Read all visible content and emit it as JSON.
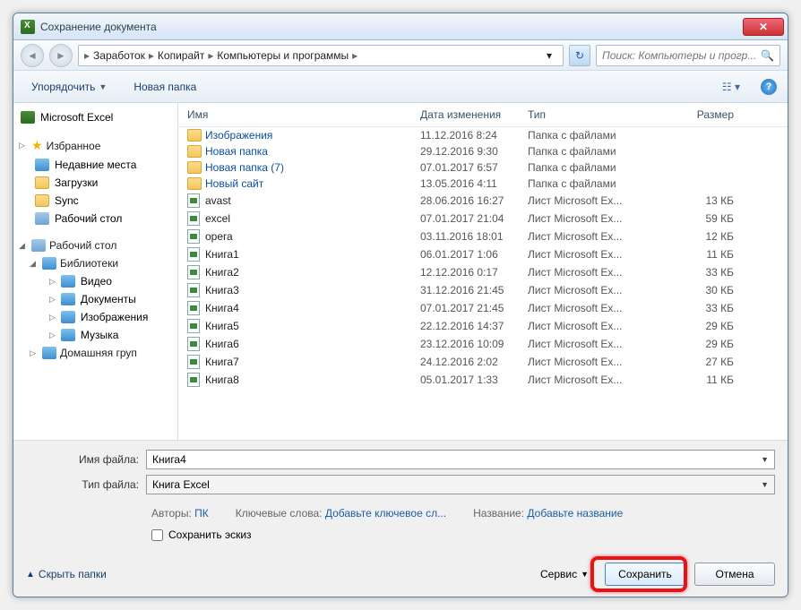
{
  "window": {
    "title": "Сохранение документа"
  },
  "nav": {
    "breadcrumb": [
      "Заработок",
      "Копирайт",
      "Компьютеры и программы"
    ],
    "search_placeholder": "Поиск: Компьютеры и прогр..."
  },
  "toolbar": {
    "organize": "Упорядочить",
    "new_folder": "Новая папка"
  },
  "sidebar": {
    "app": "Microsoft Excel",
    "favorites": "Избранное",
    "fav_items": [
      "Недавние места",
      "Загрузки",
      "Sync",
      "Рабочий стол"
    ],
    "desktop": "Рабочий стол",
    "libraries": "Библиотеки",
    "lib_items": [
      "Видео",
      "Документы",
      "Изображения",
      "Музыка"
    ],
    "homegroup": "Домашняя груп"
  },
  "columns": {
    "name": "Имя",
    "date": "Дата изменения",
    "type": "Тип",
    "size": "Размер"
  },
  "files": [
    {
      "name": "Изображения",
      "date": "11.12.2016 8:24",
      "type": "Папка с файлами",
      "size": "",
      "icon": "folder",
      "link": true
    },
    {
      "name": "Новая папка",
      "date": "29.12.2016 9:30",
      "type": "Папка с файлами",
      "size": "",
      "icon": "folder",
      "link": true
    },
    {
      "name": "Новая папка (7)",
      "date": "07.01.2017 6:57",
      "type": "Папка с файлами",
      "size": "",
      "icon": "folder",
      "link": true
    },
    {
      "name": "Новый сайт",
      "date": "13.05.2016 4:11",
      "type": "Папка с файлами",
      "size": "",
      "icon": "folder",
      "link": true
    },
    {
      "name": "avast",
      "date": "28.06.2016 16:27",
      "type": "Лист Microsoft Ex...",
      "size": "13 КБ",
      "icon": "xls"
    },
    {
      "name": "excel",
      "date": "07.01.2017 21:04",
      "type": "Лист Microsoft Ex...",
      "size": "59 КБ",
      "icon": "xls"
    },
    {
      "name": "opera",
      "date": "03.11.2016 18:01",
      "type": "Лист Microsoft Ex...",
      "size": "12 КБ",
      "icon": "xls"
    },
    {
      "name": "Книга1",
      "date": "06.01.2017 1:06",
      "type": "Лист Microsoft Ex...",
      "size": "11 КБ",
      "icon": "xls"
    },
    {
      "name": "Книга2",
      "date": "12.12.2016 0:17",
      "type": "Лист Microsoft Ex...",
      "size": "33 КБ",
      "icon": "xls"
    },
    {
      "name": "Книга3",
      "date": "31.12.2016 21:45",
      "type": "Лист Microsoft Ex...",
      "size": "30 КБ",
      "icon": "xls"
    },
    {
      "name": "Книга4",
      "date": "07.01.2017 21:45",
      "type": "Лист Microsoft Ex...",
      "size": "33 КБ",
      "icon": "xls"
    },
    {
      "name": "Книга5",
      "date": "22.12.2016 14:37",
      "type": "Лист Microsoft Ex...",
      "size": "29 КБ",
      "icon": "xls"
    },
    {
      "name": "Книга6",
      "date": "23.12.2016 10:09",
      "type": "Лист Microsoft Ex...",
      "size": "29 КБ",
      "icon": "xls"
    },
    {
      "name": "Книга7",
      "date": "24.12.2016 2:02",
      "type": "Лист Microsoft Ex...",
      "size": "27 КБ",
      "icon": "xls"
    },
    {
      "name": "Книга8",
      "date": "05.01.2017 1:33",
      "type": "Лист Microsoft Ex...",
      "size": "11 КБ",
      "icon": "xls"
    }
  ],
  "form": {
    "filename_label": "Имя файла:",
    "filename_value": "Книга4",
    "filetype_label": "Тип файла:",
    "filetype_value": "Книга Excel"
  },
  "meta": {
    "authors_label": "Авторы:",
    "authors_value": "ПК",
    "keywords_label": "Ключевые слова:",
    "keywords_value": "Добавьте ключевое сл...",
    "title_label": "Название:",
    "title_value": "Добавьте название",
    "thumbnail": "Сохранить эскиз"
  },
  "footer": {
    "hide_folders": "Скрыть папки",
    "service": "Сервис",
    "save": "Сохранить",
    "cancel": "Отмена"
  }
}
